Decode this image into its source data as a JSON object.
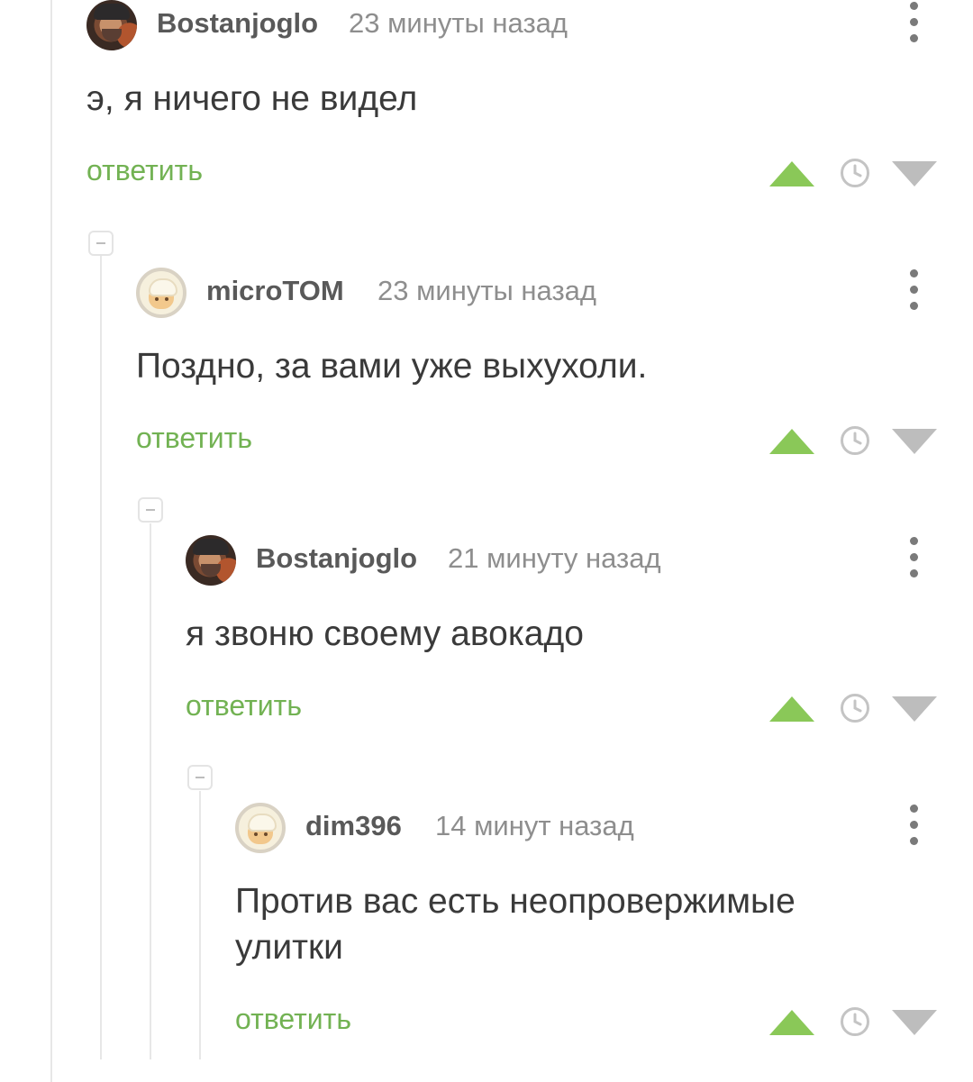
{
  "reply_label": "ответить",
  "colors": {
    "reply_link": "#72b253",
    "vote_up": "#8ac858",
    "vote_down": "#bdbdbd",
    "username": "#595959",
    "timestamp": "#8e8e8e"
  },
  "comments": [
    {
      "author": "Bostanjoglo",
      "time": "23 минуты назад",
      "text": "э, я ничего не видел",
      "avatar": "portrait-avatar"
    },
    {
      "author": "microTOM",
      "time": "23 минуты назад",
      "text": "Поздно, за вами уже выхухоли.",
      "avatar": "mushroom-avatar"
    },
    {
      "author": "Bostanjoglo",
      "time": "21 минуту назад",
      "text": "я звоню своему авокадо",
      "avatar": "portrait-avatar"
    },
    {
      "author": "dim396",
      "time": "14 минут назад",
      "text": "Против вас есть неопровержимые улитки",
      "avatar": "mushroom-avatar"
    }
  ],
  "icons": [
    "more-vertical-icon",
    "vote-up-icon",
    "clock-icon",
    "vote-down-icon",
    "collapse-icon"
  ]
}
